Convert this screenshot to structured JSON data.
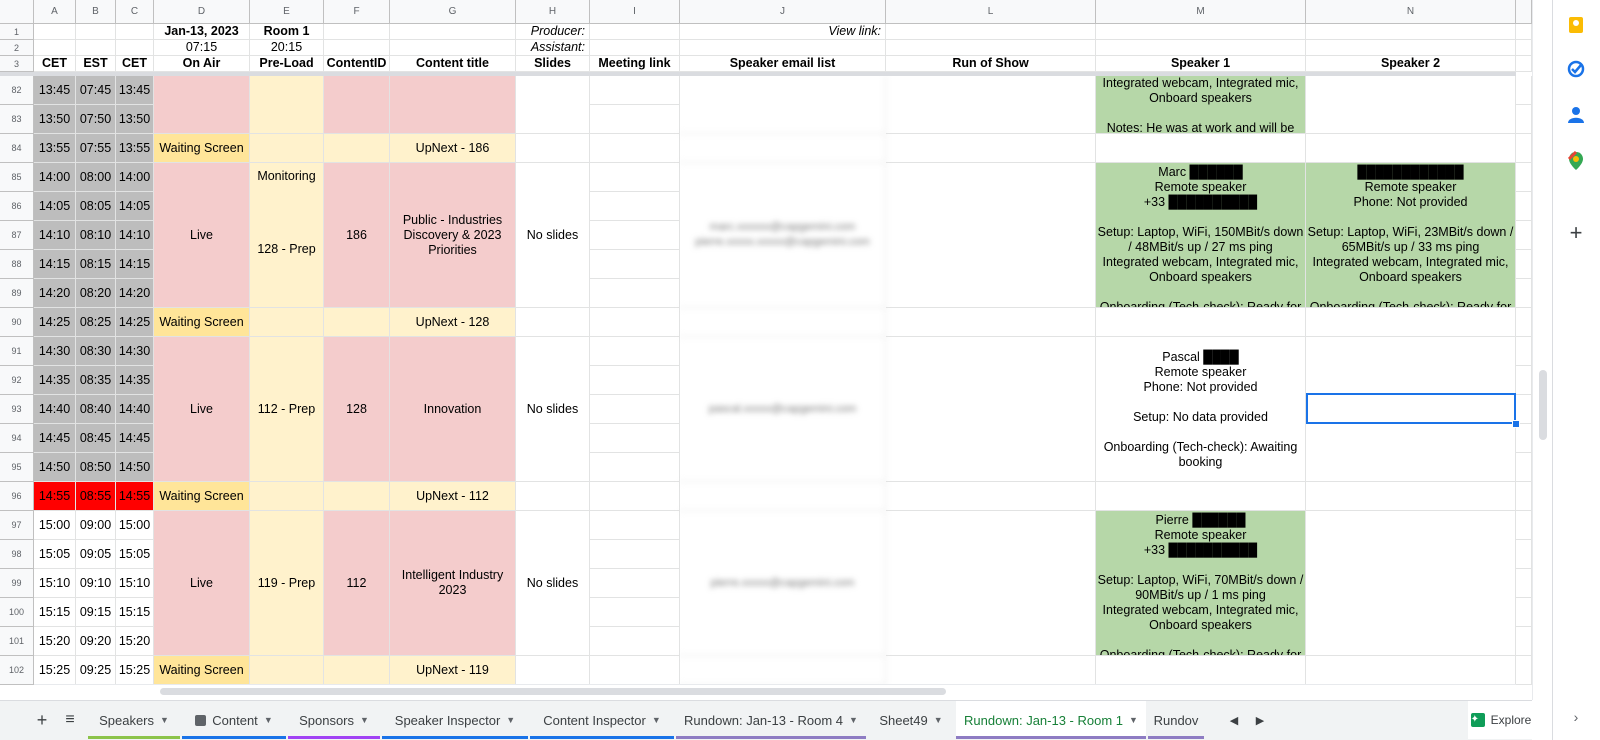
{
  "columns": [
    {
      "letter": "A",
      "w": 42
    },
    {
      "letter": "B",
      "w": 40
    },
    {
      "letter": "C",
      "w": 38
    },
    {
      "letter": "D",
      "w": 96
    },
    {
      "letter": "E",
      "w": 74
    },
    {
      "letter": "F",
      "w": 66
    },
    {
      "letter": "G",
      "w": 126
    },
    {
      "letter": "H",
      "w": 74
    },
    {
      "letter": "I",
      "w": 90
    },
    {
      "letter": "J",
      "w": 206
    },
    {
      "letter": "L",
      "w": 210
    },
    {
      "letter": "M",
      "w": 210
    },
    {
      "letter": "N",
      "w": 210
    },
    {
      "letter": "",
      "w": 16
    }
  ],
  "header_rows": {
    "r1": {
      "num": "1",
      "date": "Jan-13, 2023",
      "room": "Room 1",
      "producer_label": "Producer:",
      "view_link_label": "View link:"
    },
    "r2": {
      "num": "2",
      "start": "07:15",
      "end": "20:15",
      "assistant_label": "Assistant:"
    },
    "r3": {
      "num": "3",
      "cols": [
        "CET",
        "EST",
        "CET",
        "On Air",
        "Pre-Load",
        "ContentID",
        "Content title",
        "Slides",
        "Meeting link",
        "Speaker email list",
        "Run of Show",
        "Speaker 1",
        "Speaker 2"
      ]
    }
  },
  "rows": [
    {
      "num": "82",
      "cet": "13:45",
      "est": "07:45",
      "cet2": "13:45"
    },
    {
      "num": "83",
      "cet": "13:50",
      "est": "07:50",
      "cet2": "13:50"
    },
    {
      "num": "84",
      "cet": "13:55",
      "est": "07:55",
      "cet2": "13:55"
    },
    {
      "num": "85",
      "cet": "14:00",
      "est": "08:00",
      "cet2": "14:00"
    },
    {
      "num": "86",
      "cet": "14:05",
      "est": "08:05",
      "cet2": "14:05"
    },
    {
      "num": "87",
      "cet": "14:10",
      "est": "08:10",
      "cet2": "14:10"
    },
    {
      "num": "88",
      "cet": "14:15",
      "est": "08:15",
      "cet2": "14:15"
    },
    {
      "num": "89",
      "cet": "14:20",
      "est": "08:20",
      "cet2": "14:20"
    },
    {
      "num": "90",
      "cet": "14:25",
      "est": "08:25",
      "cet2": "14:25"
    },
    {
      "num": "91",
      "cet": "14:30",
      "est": "08:30",
      "cet2": "14:30"
    },
    {
      "num": "92",
      "cet": "14:35",
      "est": "08:35",
      "cet2": "14:35"
    },
    {
      "num": "93",
      "cet": "14:40",
      "est": "08:40",
      "cet2": "14:40"
    },
    {
      "num": "94",
      "cet": "14:45",
      "est": "08:45",
      "cet2": "14:45"
    },
    {
      "num": "95",
      "cet": "14:50",
      "est": "08:50",
      "cet2": "14:50"
    },
    {
      "num": "96",
      "cet": "14:55",
      "est": "08:55",
      "cet2": "14:55",
      "current": true
    },
    {
      "num": "97",
      "cet": "15:00",
      "est": "09:00",
      "cet2": "15:00",
      "future": true
    },
    {
      "num": "98",
      "cet": "15:05",
      "est": "09:05",
      "cet2": "15:05",
      "future": true
    },
    {
      "num": "99",
      "cet": "15:10",
      "est": "09:10",
      "cet2": "15:10",
      "future": true
    },
    {
      "num": "100",
      "cet": "15:15",
      "est": "09:15",
      "cet2": "15:15",
      "future": true
    },
    {
      "num": "101",
      "cet": "15:20",
      "est": "09:20",
      "cet2": "15:20",
      "future": true
    },
    {
      "num": "102",
      "cet": "15:25",
      "est": "09:25",
      "cet2": "15:25",
      "future": true
    }
  ],
  "blocks": [
    {
      "start": 0,
      "span": 2,
      "onair": "",
      "preload": "",
      "contentid": "",
      "title": "",
      "slides": "",
      "color": "pink",
      "speaker1": "Integrated webcam, Integrated mic, Onboard speakers\n\nNotes: He was at work and will be",
      "s1color": "green",
      "speaker2": "",
      "s2color": ""
    },
    {
      "start": 2,
      "span": 1,
      "onair": "Waiting Screen",
      "preload": "",
      "contentid": "",
      "title": "UpNext - 186",
      "slides": "",
      "color": "yellow",
      "speaker1": "",
      "s1color": "",
      "speaker2": "",
      "s2color": ""
    },
    {
      "start": 3,
      "span": 5,
      "onair": "Live",
      "preload": "128 - Prep",
      "preload_top": "Monitoring",
      "contentid": "186",
      "title": "Public - Industries Discovery & 2023 Priorities",
      "slides": "No slides",
      "color": "pink",
      "email": "marc.xxxxxx@capgemini.com\npierre.xxxxx.xxxxx@capgemini.com",
      "speaker1": "Marc ██████\nRemote speaker\n+33 ██████████\n\nSetup: Laptop, WiFi, 150MBit/s down / 48MBit/s up / 27 ms ping\nIntegrated webcam, Integrated mic, Onboard speakers\n\nOnboarding (Tech-check): Ready for",
      "s1color": "green",
      "speaker2": "████████████\nRemote speaker\nPhone: Not provided\n\nSetup: Laptop, WiFi, 23MBit/s down / 65MBit/s up / 33 ms ping\nIntegrated webcam, Integrated mic, Onboard speakers\n\nOnboarding (Tech-check): Ready for",
      "s2color": "green"
    },
    {
      "start": 8,
      "span": 1,
      "onair": "Waiting Screen",
      "preload": "",
      "contentid": "",
      "title": "UpNext - 128",
      "slides": "",
      "color": "yellow",
      "speaker1": "",
      "s1color": "",
      "speaker2": "",
      "s2color": ""
    },
    {
      "start": 9,
      "span": 5,
      "onair": "Live",
      "preload": "112 - Prep",
      "contentid": "128",
      "title": "Innovation",
      "slides": "No slides",
      "color": "pink",
      "email": "pascal.xxxxx@capgemini.com",
      "speaker1": "Pascal ████\nRemote speaker\nPhone: Not provided\n\nSetup: No data provided\n\nOnboarding (Tech-check): Awaiting booking",
      "s1color": "",
      "speaker2": "",
      "s2color": ""
    },
    {
      "start": 14,
      "span": 1,
      "onair": "Waiting Screen",
      "preload": "",
      "contentid": "",
      "title": "UpNext - 112",
      "slides": "",
      "color": "yellow",
      "speaker1": "",
      "s1color": "",
      "speaker2": "",
      "s2color": ""
    },
    {
      "start": 15,
      "span": 5,
      "onair": "Live",
      "preload": "119 - Prep",
      "contentid": "112",
      "title": "Intelligent Industry 2023",
      "slides": "No slides",
      "color": "pink",
      "email": "pierre.xxxxx@capgemini.com",
      "speaker1": "Pierre ██████\nRemote speaker\n+33 ██████████\n\nSetup: Laptop, WiFi, 70MBit/s down / 90MBit/s up / 1 ms ping\nIntegrated webcam, Integrated mic, Onboard speakers\n\nOnboarding (Tech-check): Ready for",
      "s1color": "green",
      "speaker2": "",
      "s2color": ""
    },
    {
      "start": 20,
      "span": 1,
      "onair": "Waiting Screen",
      "preload": "",
      "contentid": "",
      "title": "UpNext - 119",
      "slides": "",
      "color": "yellow",
      "speaker1": "",
      "s1color": "",
      "speaker2": "",
      "s2color": ""
    }
  ],
  "tabs": [
    {
      "label": "Speakers",
      "color": "#8bc34a",
      "caret": true,
      "w": 92
    },
    {
      "label": "Content",
      "color": "#1a73e8",
      "caret": true,
      "w": 104,
      "icon": true
    },
    {
      "label": "Sponsors",
      "color": "#a142f4",
      "caret": true,
      "w": 92
    },
    {
      "label": "Speaker Inspector",
      "color": "#1a73e8",
      "caret": true,
      "w": 146
    },
    {
      "label": "Content Inspector",
      "color": "#1a73e8",
      "caret": true,
      "w": 144
    },
    {
      "label": "Rundown: Jan-13 - Room 4",
      "color": "#8e7cc3",
      "caret": true,
      "w": 190
    },
    {
      "label": "Sheet49",
      "color": "",
      "caret": true,
      "w": 86
    },
    {
      "label": "Rundown: Jan-13 - Room 1",
      "color": "#8e7cc3",
      "caret": true,
      "w": 190,
      "active": true
    },
    {
      "label": "Rundov",
      "color": "#8e7cc3",
      "caret": false,
      "w": 56
    }
  ],
  "explore_label": "Explore"
}
